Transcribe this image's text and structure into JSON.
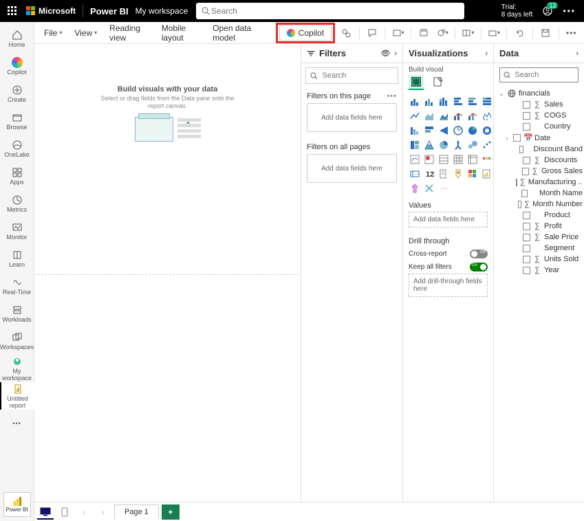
{
  "topbar": {
    "brand": "Power BI",
    "msText": "Microsoft",
    "workspace": "My workspace",
    "searchPlaceholder": "Search",
    "trialLine1": "Trial:",
    "trialLine2": "8 days left",
    "notificationCount": "12"
  },
  "leftnav": {
    "items": [
      {
        "key": "home",
        "label": "Home"
      },
      {
        "key": "copilot",
        "label": "Copilot"
      },
      {
        "key": "create",
        "label": "Create"
      },
      {
        "key": "browse",
        "label": "Browse"
      },
      {
        "key": "onelake",
        "label": "OneLake"
      },
      {
        "key": "apps",
        "label": "Apps"
      },
      {
        "key": "metrics",
        "label": "Metrics"
      },
      {
        "key": "monitor",
        "label": "Monitor"
      },
      {
        "key": "learn",
        "label": "Learn"
      },
      {
        "key": "realtime",
        "label": "Real-Time"
      },
      {
        "key": "workloads",
        "label": "Workloads"
      },
      {
        "key": "workspaces",
        "label": "Workspaces"
      },
      {
        "key": "myworkspace",
        "label": "My workspace"
      },
      {
        "key": "untitled",
        "label": "Untitled report"
      }
    ],
    "powerBiBtn": "Power BI"
  },
  "ribbon": {
    "file": "File",
    "view": "View",
    "reading": "Reading view",
    "mobile": "Mobile layout",
    "openModel": "Open data model",
    "copilot": "Copilot"
  },
  "canvas": {
    "title": "Build visuals with your data",
    "sub1": "Select or drag fields from the Data pane onto the",
    "sub2": "report canvas."
  },
  "filters": {
    "title": "Filters",
    "searchPlaceholder": "Search",
    "sectionPage": "Filters on this page",
    "sectionAll": "Filters on all pages",
    "dropText": "Add data fields here"
  },
  "viz": {
    "title": "Visualizations",
    "sub": "Build visual",
    "values": "Values",
    "valuesDrop": "Add data fields here",
    "drill": "Drill through",
    "cross": "Cross-report",
    "crossState": "Off",
    "keep": "Keep all filters",
    "keepState": "On",
    "drillDrop": "Add drill-through fields here"
  },
  "data": {
    "title": "Data",
    "searchPlaceholder": "Search",
    "table": "financials",
    "fields": [
      {
        "name": "Sales",
        "sigma": true
      },
      {
        "name": "COGS",
        "sigma": true
      },
      {
        "name": "Country",
        "sigma": false
      },
      {
        "name": "Date",
        "sigma": false,
        "date": true,
        "expand": true
      },
      {
        "name": "Discount Band",
        "sigma": false
      },
      {
        "name": "Discounts",
        "sigma": true
      },
      {
        "name": "Gross Sales",
        "sigma": true
      },
      {
        "name": "Manufacturing ...",
        "sigma": true
      },
      {
        "name": "Month Name",
        "sigma": false
      },
      {
        "name": "Month Number",
        "sigma": true
      },
      {
        "name": "Product",
        "sigma": false
      },
      {
        "name": "Profit",
        "sigma": true
      },
      {
        "name": "Sale Price",
        "sigma": true
      },
      {
        "name": "Segment",
        "sigma": false
      },
      {
        "name": "Units Sold",
        "sigma": true
      },
      {
        "name": "Year",
        "sigma": true
      }
    ]
  },
  "pagebar": {
    "page1": "Page 1"
  }
}
